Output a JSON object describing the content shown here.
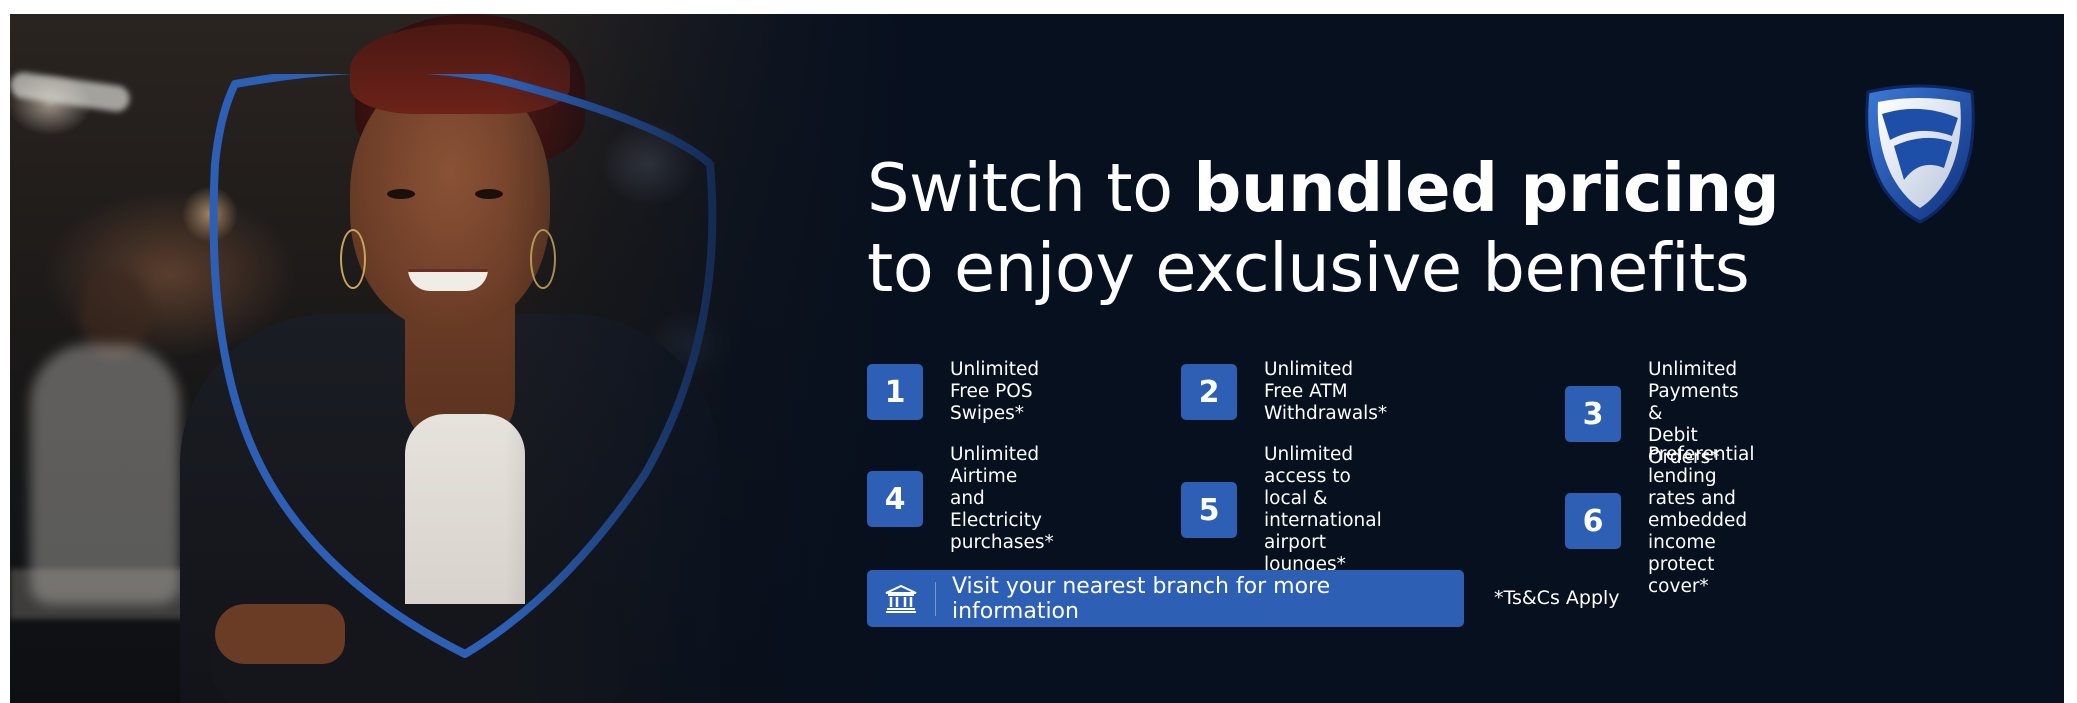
{
  "headline": {
    "line1_regular": "Switch to ",
    "line1_bold": "bundled pricing",
    "line2": "to enjoy exclusive benefits"
  },
  "benefits": [
    {
      "number": "1",
      "text": "Unlimited Free POS\nSwipes*"
    },
    {
      "number": "2",
      "text": "Unlimited Free ATM\nWithdrawals*"
    },
    {
      "number": "3",
      "text": "Unlimited Payments &\nDebit Orders*"
    },
    {
      "number": "4",
      "text": "Unlimited Airtime and\nElectricity purchases*"
    },
    {
      "number": "5",
      "text": "Unlimited access to local &\ninternational airport lounges*"
    },
    {
      "number": "6",
      "text": "Preferential lending rates and\nembedded income protect cover*"
    }
  ],
  "cta": {
    "label": "Visit your nearest branch for more information",
    "icon": "bank-icon"
  },
  "disclaimer": "*Ts&Cs Apply",
  "logo": {
    "icon": "bank-shield-logo"
  },
  "colors": {
    "background": "#07101f",
    "accent": "#2d5fb4",
    "text": "#ffffff"
  }
}
